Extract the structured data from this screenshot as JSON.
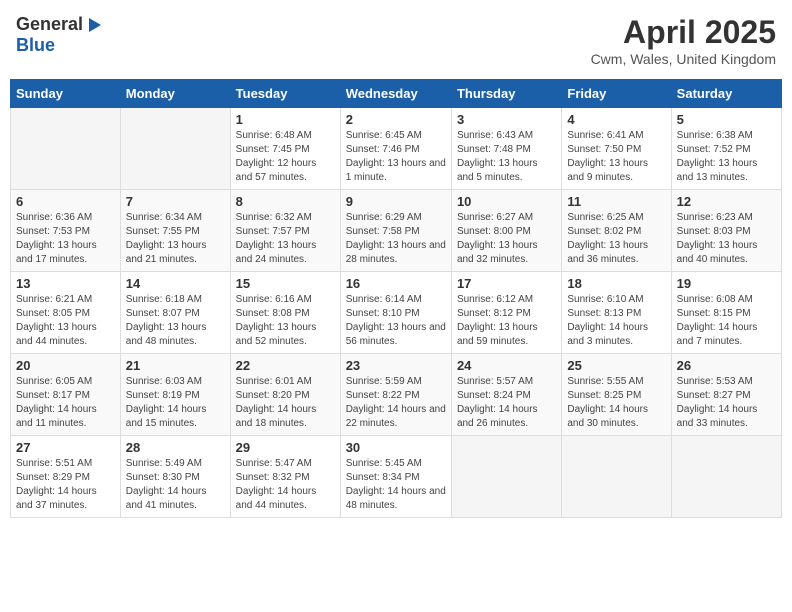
{
  "header": {
    "logo_general": "General",
    "logo_blue": "Blue",
    "month_title": "April 2025",
    "location": "Cwm, Wales, United Kingdom"
  },
  "weekdays": [
    "Sunday",
    "Monday",
    "Tuesday",
    "Wednesday",
    "Thursday",
    "Friday",
    "Saturday"
  ],
  "weeks": [
    [
      {
        "day": "",
        "info": ""
      },
      {
        "day": "",
        "info": ""
      },
      {
        "day": "1",
        "info": "Sunrise: 6:48 AM\nSunset: 7:45 PM\nDaylight: 12 hours and 57 minutes."
      },
      {
        "day": "2",
        "info": "Sunrise: 6:45 AM\nSunset: 7:46 PM\nDaylight: 13 hours and 1 minute."
      },
      {
        "day": "3",
        "info": "Sunrise: 6:43 AM\nSunset: 7:48 PM\nDaylight: 13 hours and 5 minutes."
      },
      {
        "day": "4",
        "info": "Sunrise: 6:41 AM\nSunset: 7:50 PM\nDaylight: 13 hours and 9 minutes."
      },
      {
        "day": "5",
        "info": "Sunrise: 6:38 AM\nSunset: 7:52 PM\nDaylight: 13 hours and 13 minutes."
      }
    ],
    [
      {
        "day": "6",
        "info": "Sunrise: 6:36 AM\nSunset: 7:53 PM\nDaylight: 13 hours and 17 minutes."
      },
      {
        "day": "7",
        "info": "Sunrise: 6:34 AM\nSunset: 7:55 PM\nDaylight: 13 hours and 21 minutes."
      },
      {
        "day": "8",
        "info": "Sunrise: 6:32 AM\nSunset: 7:57 PM\nDaylight: 13 hours and 24 minutes."
      },
      {
        "day": "9",
        "info": "Sunrise: 6:29 AM\nSunset: 7:58 PM\nDaylight: 13 hours and 28 minutes."
      },
      {
        "day": "10",
        "info": "Sunrise: 6:27 AM\nSunset: 8:00 PM\nDaylight: 13 hours and 32 minutes."
      },
      {
        "day": "11",
        "info": "Sunrise: 6:25 AM\nSunset: 8:02 PM\nDaylight: 13 hours and 36 minutes."
      },
      {
        "day": "12",
        "info": "Sunrise: 6:23 AM\nSunset: 8:03 PM\nDaylight: 13 hours and 40 minutes."
      }
    ],
    [
      {
        "day": "13",
        "info": "Sunrise: 6:21 AM\nSunset: 8:05 PM\nDaylight: 13 hours and 44 minutes."
      },
      {
        "day": "14",
        "info": "Sunrise: 6:18 AM\nSunset: 8:07 PM\nDaylight: 13 hours and 48 minutes."
      },
      {
        "day": "15",
        "info": "Sunrise: 6:16 AM\nSunset: 8:08 PM\nDaylight: 13 hours and 52 minutes."
      },
      {
        "day": "16",
        "info": "Sunrise: 6:14 AM\nSunset: 8:10 PM\nDaylight: 13 hours and 56 minutes."
      },
      {
        "day": "17",
        "info": "Sunrise: 6:12 AM\nSunset: 8:12 PM\nDaylight: 13 hours and 59 minutes."
      },
      {
        "day": "18",
        "info": "Sunrise: 6:10 AM\nSunset: 8:13 PM\nDaylight: 14 hours and 3 minutes."
      },
      {
        "day": "19",
        "info": "Sunrise: 6:08 AM\nSunset: 8:15 PM\nDaylight: 14 hours and 7 minutes."
      }
    ],
    [
      {
        "day": "20",
        "info": "Sunrise: 6:05 AM\nSunset: 8:17 PM\nDaylight: 14 hours and 11 minutes."
      },
      {
        "day": "21",
        "info": "Sunrise: 6:03 AM\nSunset: 8:19 PM\nDaylight: 14 hours and 15 minutes."
      },
      {
        "day": "22",
        "info": "Sunrise: 6:01 AM\nSunset: 8:20 PM\nDaylight: 14 hours and 18 minutes."
      },
      {
        "day": "23",
        "info": "Sunrise: 5:59 AM\nSunset: 8:22 PM\nDaylight: 14 hours and 22 minutes."
      },
      {
        "day": "24",
        "info": "Sunrise: 5:57 AM\nSunset: 8:24 PM\nDaylight: 14 hours and 26 minutes."
      },
      {
        "day": "25",
        "info": "Sunrise: 5:55 AM\nSunset: 8:25 PM\nDaylight: 14 hours and 30 minutes."
      },
      {
        "day": "26",
        "info": "Sunrise: 5:53 AM\nSunset: 8:27 PM\nDaylight: 14 hours and 33 minutes."
      }
    ],
    [
      {
        "day": "27",
        "info": "Sunrise: 5:51 AM\nSunset: 8:29 PM\nDaylight: 14 hours and 37 minutes."
      },
      {
        "day": "28",
        "info": "Sunrise: 5:49 AM\nSunset: 8:30 PM\nDaylight: 14 hours and 41 minutes."
      },
      {
        "day": "29",
        "info": "Sunrise: 5:47 AM\nSunset: 8:32 PM\nDaylight: 14 hours and 44 minutes."
      },
      {
        "day": "30",
        "info": "Sunrise: 5:45 AM\nSunset: 8:34 PM\nDaylight: 14 hours and 48 minutes."
      },
      {
        "day": "",
        "info": ""
      },
      {
        "day": "",
        "info": ""
      },
      {
        "day": "",
        "info": ""
      }
    ]
  ]
}
